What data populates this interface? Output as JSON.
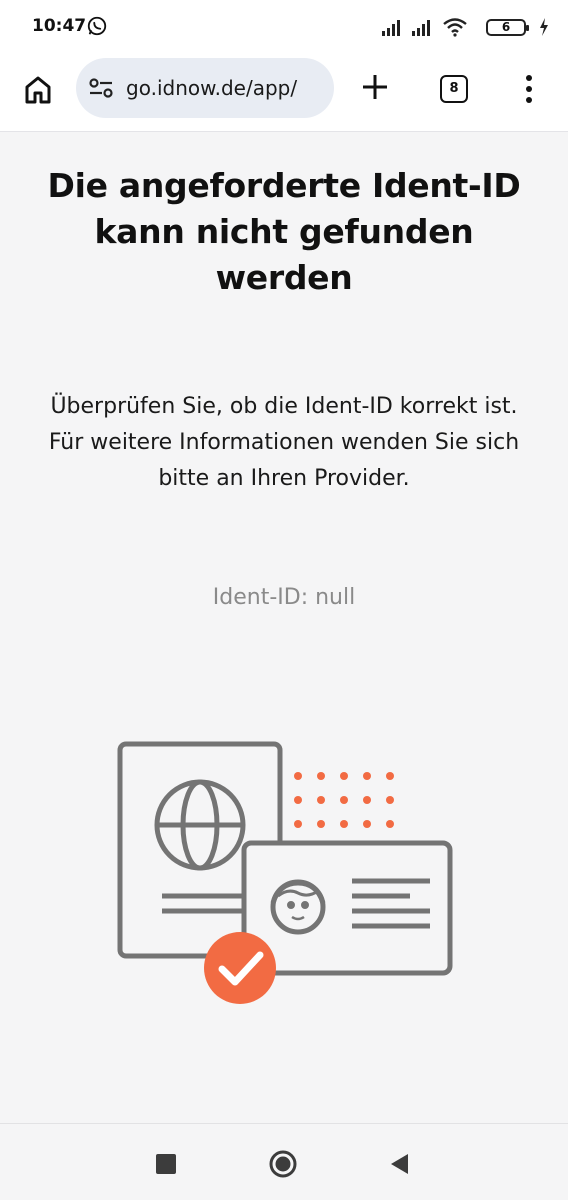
{
  "status_bar": {
    "time": "10:47",
    "battery_level": "6",
    "icons": [
      "whatsapp-icon",
      "signal-icon",
      "signal-icon",
      "wifi-icon",
      "battery-icon",
      "charging-icon"
    ]
  },
  "browser": {
    "url": "go.idnow.de/app/",
    "tab_count": "8",
    "icons": [
      "home-icon",
      "site-settings-icon",
      "plus-icon",
      "tabs-icon",
      "more-vert-icon"
    ]
  },
  "page": {
    "title": "Die angeforderte Ident-ID kann nicht gefunden werden",
    "description": "Überprüfen Sie, ob die Ident-ID korrekt ist. Für weitere Informationen wenden Sie sich bitte an Ihren Provider.",
    "ident_line": "Ident-ID: null",
    "colors": {
      "accent": "#f26b43",
      "illustration_stroke": "#747474",
      "background": "#f5f5f6"
    }
  },
  "nav_bar": {
    "icons": [
      "recents-icon",
      "home-circle-icon",
      "back-icon"
    ]
  }
}
